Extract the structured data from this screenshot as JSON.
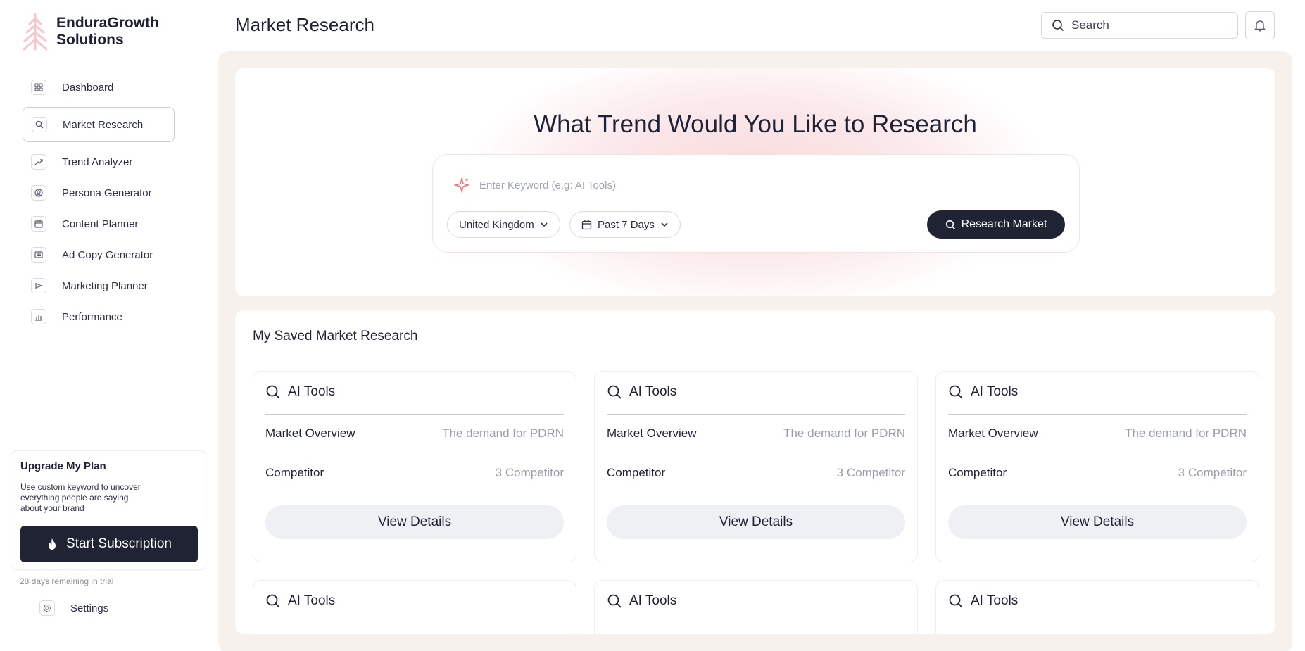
{
  "brand": {
    "name": "EnduraGrowth Solutions",
    "accent": "#f4b9bd"
  },
  "sidebar": {
    "items": [
      {
        "label": "Dashboard",
        "icon": "grid-icon"
      },
      {
        "label": "Market Research",
        "icon": "search-icon",
        "active": true
      },
      {
        "label": "Trend Analyzer",
        "icon": "trend-icon"
      },
      {
        "label": "Persona Generator",
        "icon": "persona-icon"
      },
      {
        "label": "Content Planner",
        "icon": "calendar-icon"
      },
      {
        "label": "Ad Copy Generator",
        "icon": "document-icon"
      },
      {
        "label": "Marketing Planner",
        "icon": "megaphone-icon"
      },
      {
        "label": "Performance",
        "icon": "bar-chart-icon"
      }
    ],
    "upgrade": {
      "title": "Upgrade My Plan",
      "description": "Use custom keyword to uncover everything people are saying about your brand",
      "button": "Start Subscription"
    },
    "trial": "28 days remaining in trial",
    "settings": "Settings"
  },
  "header": {
    "title": "Market Research",
    "search_placeholder": "Search"
  },
  "hero": {
    "title": "What Trend Would You Like to Research",
    "keyword_placeholder": "Enter Keyword (e.g: AI Tools)",
    "country": "United Kingdom",
    "period": "Past 7 Days",
    "research_button": "Research Market"
  },
  "saved": {
    "title": "My Saved Market Research",
    "cards": [
      {
        "title": "AI Tools",
        "overview_label": "Market Overview",
        "overview_value": "The demand for PDRN",
        "competitor_label": "Competitor",
        "competitor_value": "3 Competitor",
        "button": "View Details"
      },
      {
        "title": "AI Tools",
        "overview_label": "Market Overview",
        "overview_value": "The demand for PDRN",
        "competitor_label": "Competitor",
        "competitor_value": "3 Competitor",
        "button": "View Details"
      },
      {
        "title": "AI Tools",
        "overview_label": "Market Overview",
        "overview_value": "The demand for PDRN",
        "competitor_label": "Competitor",
        "competitor_value": "3 Competitor",
        "button": "View Details"
      },
      {
        "title": "AI Tools"
      },
      {
        "title": "AI Tools"
      },
      {
        "title": "AI Tools"
      }
    ]
  },
  "colors": {
    "dark": "#1f2333",
    "page_bg": "#f7f1ee",
    "muted": "#9a9eac"
  }
}
